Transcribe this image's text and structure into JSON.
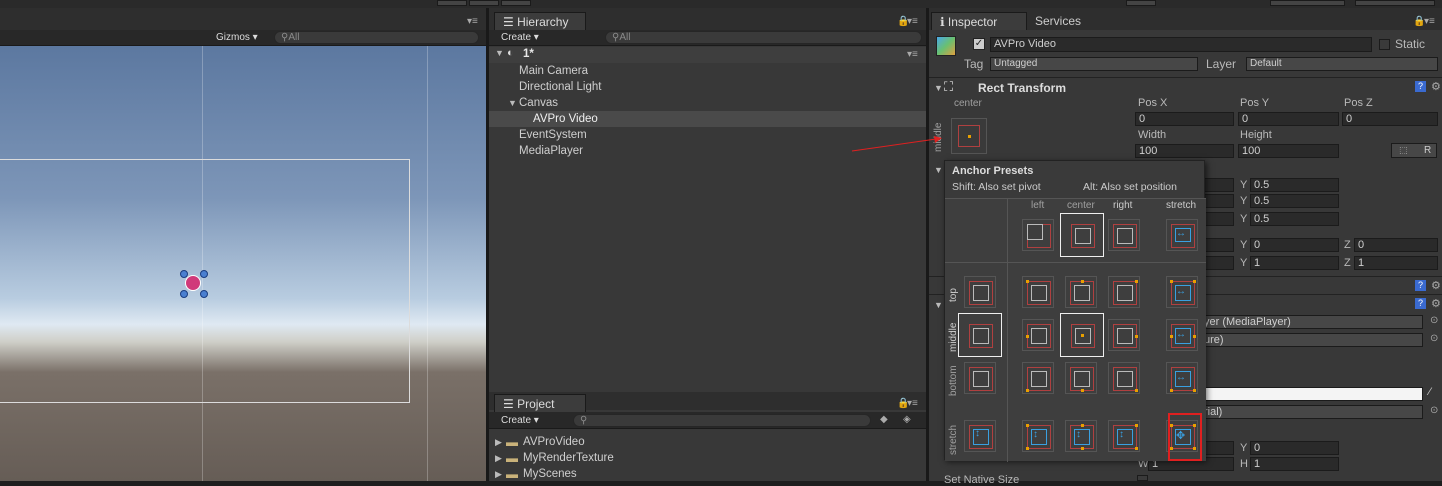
{
  "scene": {
    "gizmos_label": "Gizmos ▾",
    "search_placeholder": "All"
  },
  "hierarchy": {
    "tab_label": "Hierarchy",
    "create_label": "Create ▾",
    "search_placeholder": "All",
    "scene_name": "1*",
    "items": [
      {
        "label": "Main Camera"
      },
      {
        "label": "Directional Light"
      },
      {
        "label": "Canvas"
      },
      {
        "label": "AVPro Video"
      },
      {
        "label": "EventSystem"
      },
      {
        "label": "MediaPlayer"
      }
    ]
  },
  "project": {
    "tab_label": "Project",
    "create_label": "Create ▾",
    "folders": [
      {
        "label": "AVProVideo"
      },
      {
        "label": "MyRenderTexture"
      },
      {
        "label": "MyScenes"
      }
    ]
  },
  "inspector": {
    "tab_label": "Inspector",
    "services_label": "Services",
    "object_name": "AVPro Video",
    "static_label": "Static",
    "tag_label": "Tag",
    "tag_value": "Untagged",
    "layer_label": "Layer",
    "layer_value": "Default",
    "rect_transform_title": "Rect Transform",
    "anchor_h": "center",
    "anchor_v": "middle",
    "posx_label": "Pos X",
    "posy_label": "Pos Y",
    "posz_label": "Pos Z",
    "posx": "0",
    "posy": "0",
    "posz": "0",
    "width_label": "Width",
    "height_label": "Height",
    "width": "100",
    "height": "100",
    "r_button": "R",
    "y_vals": [
      "0.5",
      "0.5",
      "0.5"
    ],
    "rot_y": "0",
    "rot_z": "0",
    "scale_y": "1",
    "scale_z": "1",
    "y_label": "Y",
    "z_label": "Z",
    "media_player_field": "yer (MediaPlayer)",
    "texture_field": "ure)",
    "material_field": "rial)",
    "bottom_y": "0",
    "w_label": "W",
    "w_value": "1",
    "h_label": "H",
    "h_value": "1",
    "native_size": "Set Native Size"
  },
  "anchor_presets": {
    "title": "Anchor Presets",
    "shift_hint": "Shift: Also set pivot",
    "alt_hint": "Alt: Also set position",
    "col_labels": [
      "left",
      "center",
      "right",
      "stretch"
    ],
    "row_labels": [
      "top",
      "middle",
      "bottom",
      "stretch"
    ]
  },
  "colors": {
    "accent_red": "#e02020",
    "anchor_orange": "#e8a000",
    "stretch_blue": "#3aa0e0"
  }
}
